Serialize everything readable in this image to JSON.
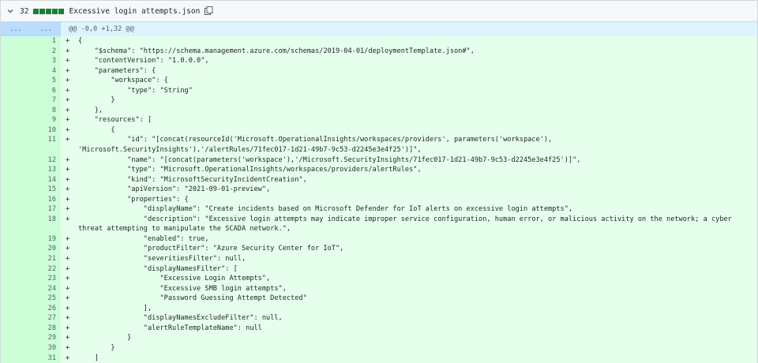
{
  "file": {
    "change_count": "32",
    "name": "Excessive login attempts.json"
  },
  "hunk": {
    "left_expand": "...",
    "right_expand": "...",
    "header": "@@ -0,0 +1,32 @@"
  },
  "lines": [
    {
      "n": "1",
      "text": "{"
    },
    {
      "n": "2",
      "text": "    \"$schema\": \"https://schema.management.azure.com/schemas/2019-04-01/deploymentTemplate.json#\","
    },
    {
      "n": "3",
      "text": "    \"contentVersion\": \"1.0.0.0\","
    },
    {
      "n": "4",
      "text": "    \"parameters\": {"
    },
    {
      "n": "5",
      "text": "        \"workspace\": {"
    },
    {
      "n": "6",
      "text": "            \"type\": \"String\""
    },
    {
      "n": "7",
      "text": "        }"
    },
    {
      "n": "8",
      "text": "    },"
    },
    {
      "n": "9",
      "text": "    \"resources\": ["
    },
    {
      "n": "10",
      "text": "        {"
    },
    {
      "n": "11",
      "text": "            \"id\": \"[concat(resourceId('Microsoft.OperationalInsights/workspaces/providers', parameters('workspace'), 'Microsoft.SecurityInsights'),'/alertRules/71fec017-1d21-49b7-9c53-d2245e3e4f25')]\","
    },
    {
      "n": "12",
      "text": "            \"name\": \"[concat(parameters('workspace'),'/Microsoft.SecurityInsights/71fec017-1d21-49b7-9c53-d2245e3e4f25')]\","
    },
    {
      "n": "13",
      "text": "            \"type\": \"Microsoft.OperationalInsights/workspaces/providers/alertRules\","
    },
    {
      "n": "14",
      "text": "            \"kind\": \"MicrosoftSecurityIncidentCreation\","
    },
    {
      "n": "15",
      "text": "            \"apiVersion\": \"2021-09-01-preview\","
    },
    {
      "n": "16",
      "text": "            \"properties\": {"
    },
    {
      "n": "17",
      "text": "                \"displayName\": \"Create incidents based on Microsoft Defender for IoT alerts on excessive login attempts\","
    },
    {
      "n": "18",
      "text": "                \"description\": \"Excessive login attempts may indicate improper service configuration, human error, or malicious activity on the network; a cyber threat attempting to manipulate the SCADA network.\","
    },
    {
      "n": "19",
      "text": "                \"enabled\": true,"
    },
    {
      "n": "20",
      "text": "                \"productFilter\": \"Azure Security Center for IoT\","
    },
    {
      "n": "21",
      "text": "                \"severitiesFilter\": null,"
    },
    {
      "n": "22",
      "text": "                \"displayNamesFilter\": ["
    },
    {
      "n": "23",
      "text": "                    \"Excessive Login Attempts\","
    },
    {
      "n": "24",
      "text": "                    \"Excessive SMB login attempts\","
    },
    {
      "n": "25",
      "text": "                    \"Password Guessing Attempt Detected\""
    },
    {
      "n": "26",
      "text": "                ],"
    },
    {
      "n": "27",
      "text": "                \"displayNamesExcludeFilter\": null,"
    },
    {
      "n": "28",
      "text": "                \"alertRuleTemplateName\": null"
    },
    {
      "n": "29",
      "text": "            }"
    },
    {
      "n": "30",
      "text": "        }"
    },
    {
      "n": "31",
      "text": "    ]"
    }
  ],
  "marker": "+",
  "colors": {
    "addition_bg": "#e6ffec",
    "addition_num_bg": "#ccffd8",
    "hunk_bg": "#ddf4ff",
    "diffstat_green": "#1a7f37"
  },
  "icons": {
    "collapse": "chevron-down-icon",
    "copy": "copy-icon"
  }
}
